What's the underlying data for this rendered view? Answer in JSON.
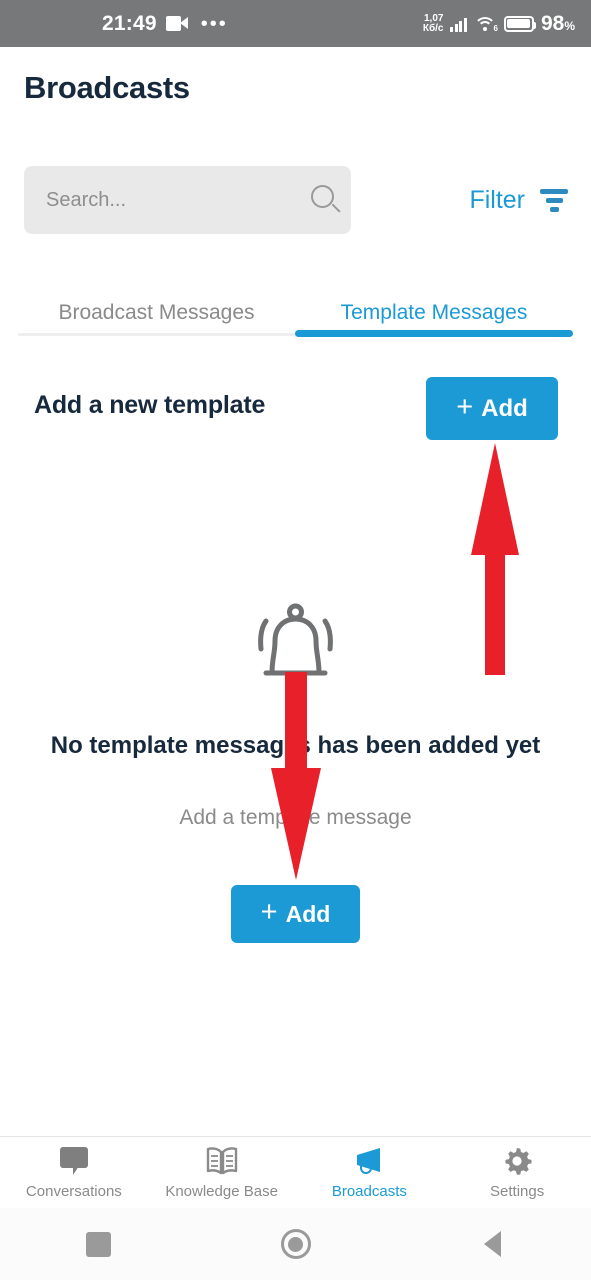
{
  "status_bar": {
    "time": "21:49",
    "recording_icon": "video-camera-icon",
    "more_icon": "ellipsis-icon",
    "network_speed_value": "1,07",
    "network_speed_unit": "Кб/с",
    "signal_icon": "cellular-signal-icon",
    "wifi_icon": "wifi-icon",
    "wifi_generation": "6",
    "battery_icon": "battery-icon",
    "battery_percent": "98",
    "battery_percent_symbol": "%"
  },
  "header": {
    "title": "Broadcasts"
  },
  "search": {
    "placeholder": "Search...",
    "value": "",
    "icon": "search-icon",
    "filter_label": "Filter",
    "filter_icon": "filter-funnel-icon"
  },
  "tabs": {
    "items": [
      {
        "label": "Broadcast Messages",
        "active": false
      },
      {
        "label": "Template Messages",
        "active": true
      }
    ]
  },
  "main": {
    "new_template_label": "Add a new template",
    "add_button_label": "Add",
    "add_button_plus": "+",
    "empty_state": {
      "icon": "notification-bell-icon",
      "title": "No template messages has been added yet",
      "subtitle": "Add a template message",
      "add_button_label": "Add",
      "add_button_plus": "+"
    }
  },
  "annotations": {
    "arrow_up": "red-arrow-up-pointing-to-add-button",
    "arrow_down": "red-arrow-down-pointing-to-add-button",
    "color": "#e8202a"
  },
  "bottom_nav": {
    "items": [
      {
        "label": "Conversations",
        "icon": "chat-bubble-icon",
        "active": false
      },
      {
        "label": "Knowledge Base",
        "icon": "open-book-icon",
        "active": false
      },
      {
        "label": "Broadcasts",
        "icon": "megaphone-icon",
        "active": true
      },
      {
        "label": "Settings",
        "icon": "gear-icon",
        "active": false
      }
    ]
  },
  "android_nav": {
    "recents": "square-recents-icon",
    "home": "circle-home-icon",
    "back": "triangle-back-icon"
  },
  "colors": {
    "accent": "#1b9ad6",
    "title": "#17293c",
    "muted": "#8a8a8a",
    "status_bar_bg": "#77787a",
    "annotation_red": "#e8202a"
  }
}
